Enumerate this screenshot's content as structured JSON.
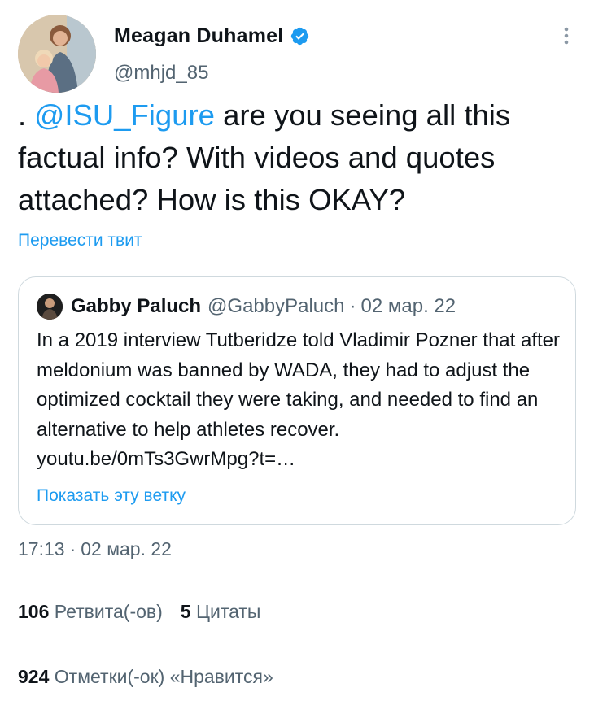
{
  "author": {
    "display_name": "Meagan Duhamel",
    "handle": "@mhjd_85",
    "verified": true
  },
  "tweet": {
    "text_prefix": ". ",
    "mention": "@ISU_Figure",
    "text_suffix": " are you seeing all this factual info? With videos and quotes attached? How is this OKAY?",
    "translate_label": "Перевести твит",
    "timestamp_time": "17:13",
    "timestamp_sep": "·",
    "timestamp_date": "02 мар. 22"
  },
  "quote": {
    "name": "Gabby Paluch",
    "handle": "@GabbyPaluch",
    "sep": "·",
    "date": "02 мар. 22",
    "text": "In a 2019 interview Tutberidze told Vladimir Pozner that after meldonium was banned by WADA, they had to adjust the optimized cocktail they were taking, and needed to find an alternative to help athletes recover. ",
    "link": "youtu.be/0mTs3GwrMpg?t=…",
    "show_thread_label": "Показать эту ветку"
  },
  "stats": {
    "retweets_count": "106",
    "retweets_label": "Ретвита(-ов)",
    "quotes_count": "5",
    "quotes_label": "Цитаты",
    "likes_count": "924",
    "likes_label": "Отметки(-ок) «Нравится»"
  },
  "icons": {
    "verified": "verified-badge-icon",
    "more": "more-vertical-icon"
  },
  "colors": {
    "accent": "#1d9bf0",
    "text_primary": "#0f1419",
    "text_secondary": "#536471",
    "border": "#cfd9de"
  }
}
